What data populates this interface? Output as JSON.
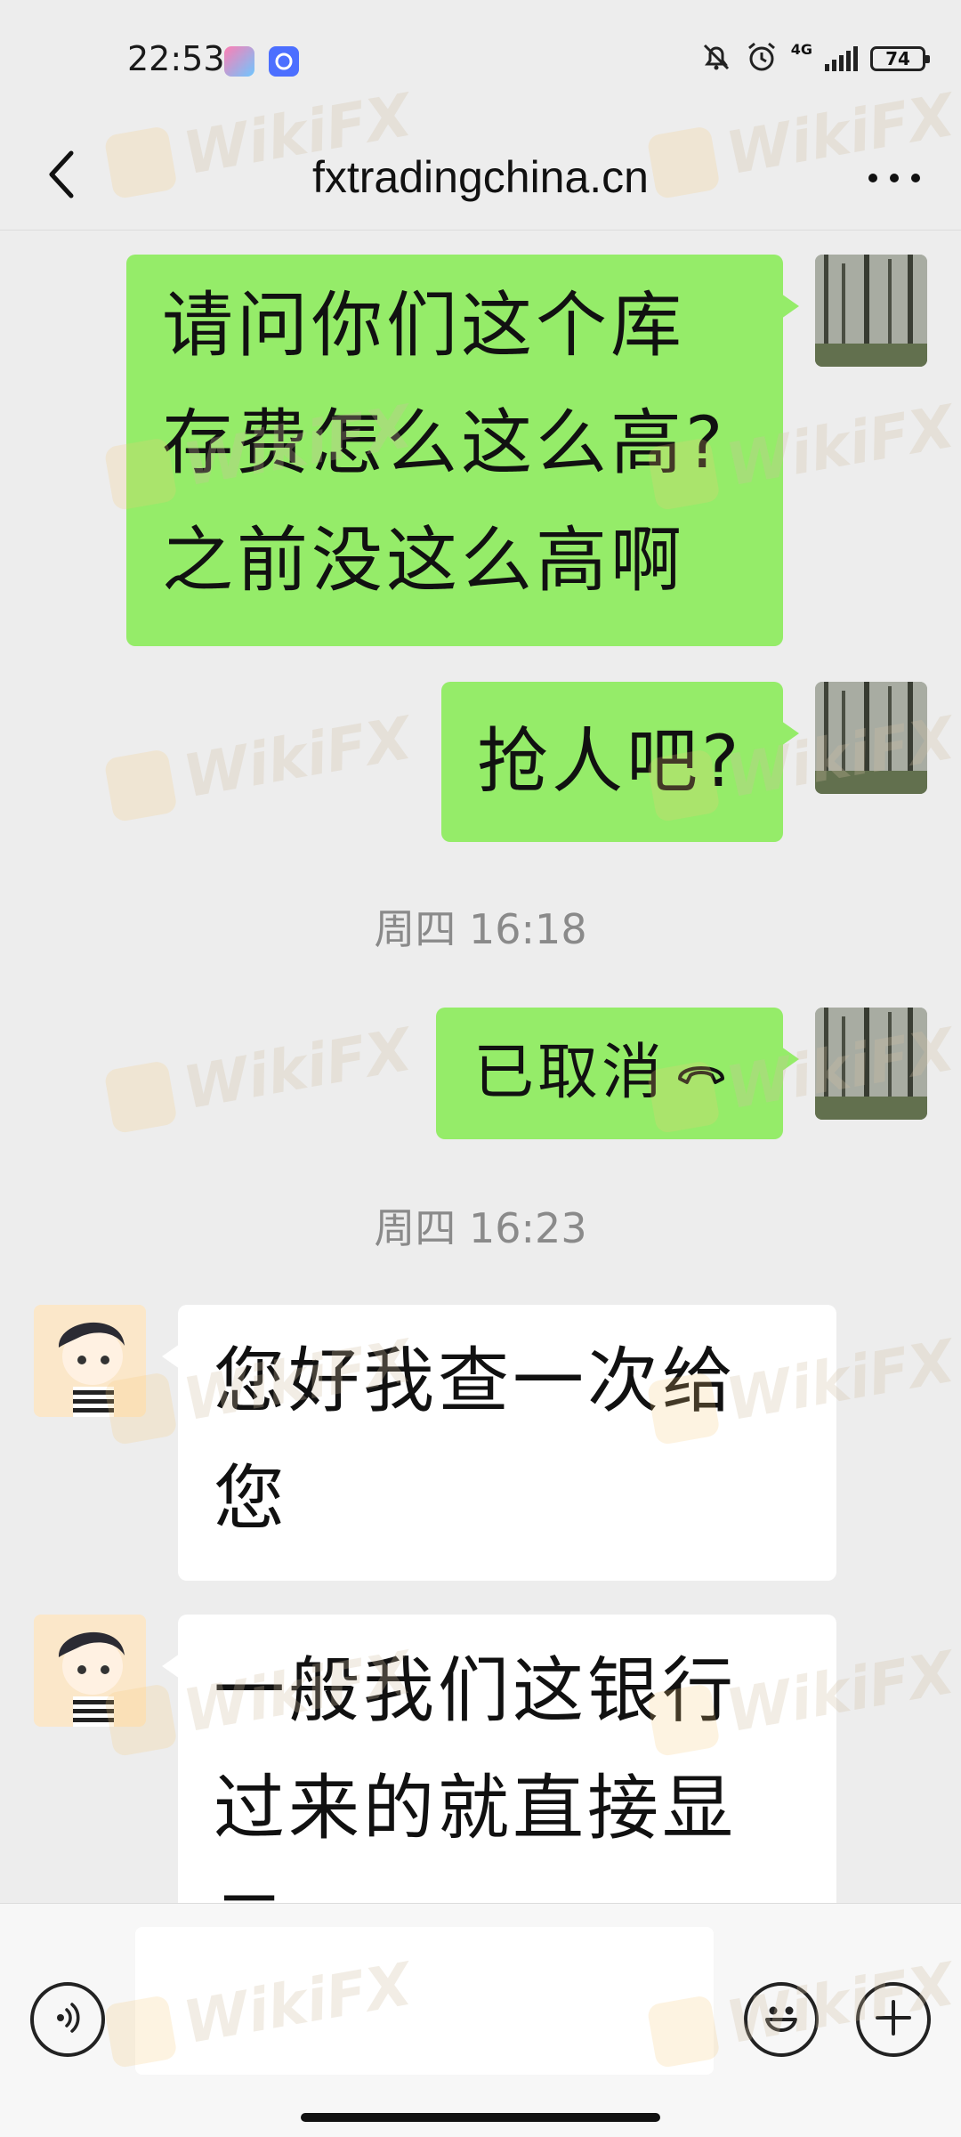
{
  "status_bar": {
    "time": "22:53",
    "network": "4G",
    "battery": "74"
  },
  "header": {
    "title": "fxtradingchina.cn"
  },
  "messages": [
    {
      "side": "out",
      "text": "请问你们这个库存费怎么这么高?之前没这么高啊"
    },
    {
      "side": "out",
      "text": "抢人吧?"
    },
    {
      "side": "time",
      "text": "周四 16:18"
    },
    {
      "side": "out",
      "text": "已取消",
      "icon": "phone-hangup-icon"
    },
    {
      "side": "time",
      "text": "周四 16:23"
    },
    {
      "side": "in",
      "text": "您好我查一次给您"
    },
    {
      "side": "in",
      "text": "一般我们这银行过来的就直接显示"
    }
  ],
  "watermark": {
    "text": "WikiFX"
  },
  "colors": {
    "out_bubble": "#95ec69",
    "in_bubble": "#ffffff",
    "background": "#ededed"
  }
}
